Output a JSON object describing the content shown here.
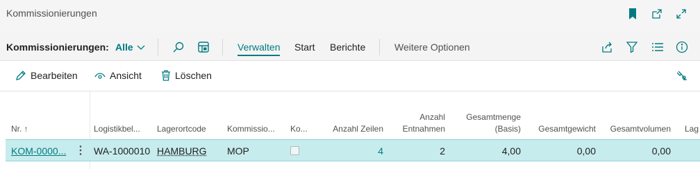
{
  "window": {
    "title": "Kommissionierungen",
    "icons": [
      "bookmark-icon",
      "open-new-window-icon",
      "expand-icon"
    ]
  },
  "actionbar": {
    "page_label": "Kommissionierungen:",
    "filter_label": "Alle",
    "tabs": [
      "Verwalten",
      "Start",
      "Berichte"
    ],
    "active_tab": "Verwalten",
    "more_label": "Weitere Optionen",
    "accent_color": "#007a80"
  },
  "commands": {
    "edit": "Bearbeiten",
    "view": "Ansicht",
    "delete": "Löschen"
  },
  "table": {
    "headers": {
      "nr": "Nr. ↑",
      "logistikbeleg": "Logistikbel...",
      "lagerortcode": "Lagerortcode",
      "kommissionierer": "Kommissio...",
      "ko": "Ko...",
      "anzahl_zeilen": "Anzahl Zeilen",
      "anzahl_entnahmen_1": "Anzahl",
      "anzahl_entnahmen_2": "Entnahmen",
      "gesamtmenge_1": "Gesamtmenge",
      "gesamtmenge_2": "(Basis)",
      "gesamtgewicht": "Gesamtgewicht",
      "gesamtvolumen": "Gesamtvolumen",
      "lag": "Lag"
    },
    "rows": [
      {
        "nr": "KOM-0000...",
        "logistikbeleg": "WA-1000010",
        "lagerortcode": "HAMBURG",
        "kommissionierer": "MOP",
        "ko": false,
        "anzahl_zeilen": "4",
        "anzahl_entnahmen": "2",
        "gesamtmenge": "4,00",
        "gesamtgewicht": "0,00",
        "gesamtvolumen": "0,00"
      }
    ],
    "selected_row_color": "#c7eced"
  }
}
